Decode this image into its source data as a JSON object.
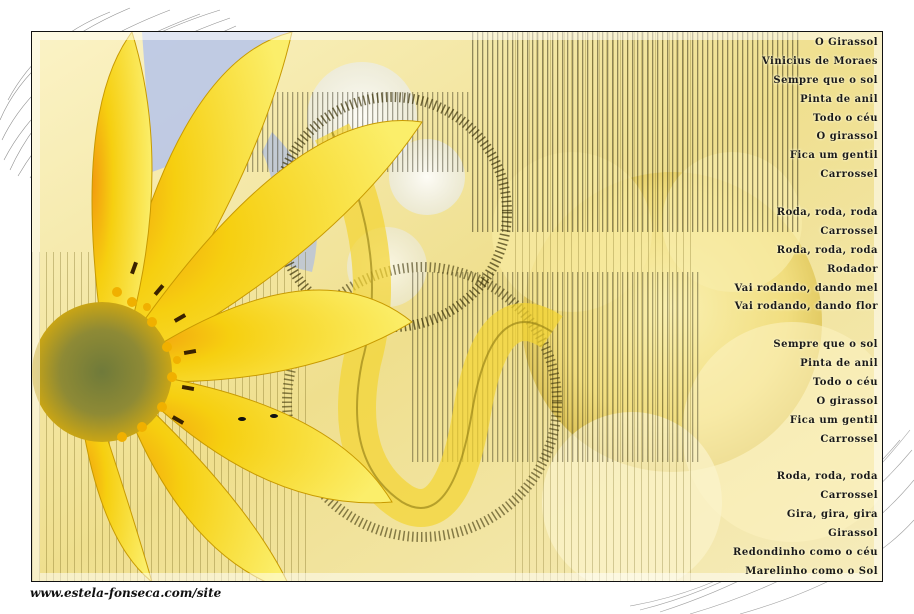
{
  "poem": {
    "lines": [
      "O Girassol",
      "Vinicius de Moraes",
      "Sempre que o sol",
      "Pinta de anil",
      "Todo o céu",
      "O girassol",
      "Fica um gentil",
      "Carrossel",
      "",
      "Roda, roda, roda",
      "Carrossel",
      "Roda, roda, roda",
      "Rodador",
      "Vai rodando, dando mel",
      "Vai rodando, dando flor",
      "",
      "Sempre que o sol",
      "Pinta de anil",
      "Todo o céu",
      "O girassol",
      "Fica um gentil",
      "Carrossel",
      "",
      "Roda, roda, roda",
      "Carrossel",
      "Gira, gira, gira",
      "Girassol",
      "Redondinho como o céu",
      "Marelinho como o Sol"
    ]
  },
  "signature": "www.estela-fonseca.com/site",
  "colors": {
    "petal": "#f7e21a",
    "petal_dark": "#e0b800",
    "background": "#f3e7a8",
    "sky": "#b9c6e8",
    "text": "#1a1a1a"
  }
}
